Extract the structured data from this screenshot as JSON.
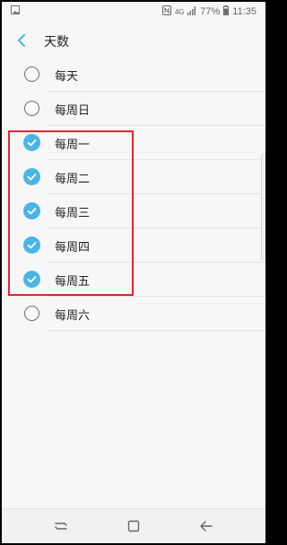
{
  "status_bar": {
    "network": "4G",
    "battery": "77%",
    "time": "11:35",
    "icons": [
      "gallery-icon",
      "nfc-icon",
      "signal-icon",
      "battery-icon"
    ]
  },
  "header": {
    "title": "天数",
    "back_icon": "chevron-left-icon"
  },
  "items": [
    {
      "label": "每天",
      "checked": false
    },
    {
      "label": "每周日",
      "checked": false
    },
    {
      "label": "每周一",
      "checked": true
    },
    {
      "label": "每周二",
      "checked": true
    },
    {
      "label": "每周三",
      "checked": true
    },
    {
      "label": "每周四",
      "checked": true
    },
    {
      "label": "每周五",
      "checked": true
    },
    {
      "label": "每周六",
      "checked": false
    }
  ],
  "colors": {
    "accent": "#4bb4e6",
    "highlight": "#e2262d",
    "background": "#f7f7f7"
  },
  "nav_bar": {
    "icons": [
      "recents-icon",
      "home-icon",
      "back-arrow-icon"
    ]
  }
}
